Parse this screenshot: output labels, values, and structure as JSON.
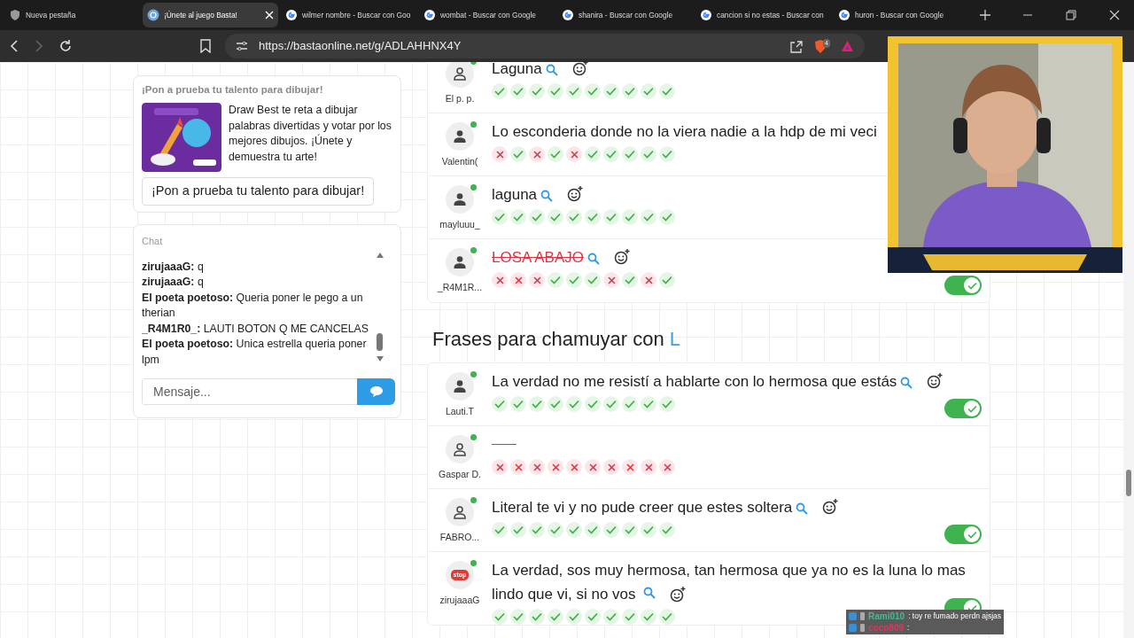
{
  "browser": {
    "tabs": [
      {
        "title": "Nueva pestaña",
        "kind": "shield",
        "selected": false
      },
      {
        "title": "¡Únete al juego Basta!",
        "kind": "game",
        "selected": true
      },
      {
        "title": "wilmer nombre - Buscar con Goo",
        "kind": "search",
        "selected": false
      },
      {
        "title": "wombat - Buscar con Google",
        "kind": "search",
        "selected": false
      },
      {
        "title": "shanira - Buscar con Google",
        "kind": "search",
        "selected": false
      },
      {
        "title": "cancion si no estas - Buscar con",
        "kind": "search",
        "selected": false
      },
      {
        "title": "huron - Buscar con Google",
        "kind": "search",
        "selected": false
      }
    ],
    "address": "https://bastaonline.net/g/ADLAHHNX4Y",
    "shield_count": "4",
    "forward_disabled": true
  },
  "promo": {
    "heading": "¡Pon a prueba tu talento para dibujar!",
    "description": "Draw Best te reta a dibujar palabras divertidas y votar por los mejores dibujos. ¡Únete y demuestra tu arte!",
    "button": "¡Pon a prueba tu talento para dibujar!"
  },
  "chat": {
    "label": "Chat",
    "messages": [
      "**zirujaaaG:** q",
      "**zirujaaaG:** q",
      "**El poeta poetoso:** Queria poner le pego a un therian",
      "**_R4M1R0_:** LAUTI BOTON Q ME CANCELAS",
      "**El poeta poetoso:** Unica estrella queria poner lpm"
    ],
    "placeholder": "Mensaje..."
  },
  "groups": [
    {
      "rows": [
        {
          "name": "El p. p.",
          "kind": "outline",
          "online": true,
          "answer": "Laguna",
          "struck": false,
          "tools": true,
          "votes": [
            {
              "approved": true
            },
            {
              "approved": true
            },
            {
              "approved": true
            },
            {
              "approved": true
            },
            {
              "approved": true
            },
            {
              "approved": true
            },
            {
              "approved": true
            },
            {
              "approved": true
            },
            {
              "approved": true
            },
            {
              "approved": true
            }
          ]
        },
        {
          "name": "Valentin(",
          "kind": "filled",
          "online": true,
          "answer": "Lo esconderia donde no la viera nadie a la hdp de mi veci",
          "struck": false,
          "tools": false,
          "votes": [
            {
              "approved": false
            },
            {
              "approved": true
            },
            {
              "approved": false
            },
            {
              "approved": true
            },
            {
              "approved": false
            },
            {
              "approved": true
            },
            {
              "approved": true
            },
            {
              "approved": true
            },
            {
              "approved": true
            },
            {
              "approved": true
            }
          ]
        },
        {
          "name": "mayluuu_",
          "kind": "filled",
          "online": true,
          "answer": "laguna",
          "struck": false,
          "tools": true,
          "votes": [
            {
              "approved": true
            },
            {
              "approved": true
            },
            {
              "approved": true
            },
            {
              "approved": true
            },
            {
              "approved": true
            },
            {
              "approved": true
            },
            {
              "approved": true
            },
            {
              "approved": true
            },
            {
              "approved": true
            },
            {
              "approved": true
            }
          ]
        },
        {
          "name": "_R4M1R...",
          "kind": "filled",
          "online": true,
          "answer": "LOSA ABAJO",
          "struck": true,
          "tools": true,
          "toggle_on": true,
          "votes": [
            {
              "approved": false
            },
            {
              "approved": false
            },
            {
              "approved": false
            },
            {
              "approved": true
            },
            {
              "approved": true
            },
            {
              "approved": true
            },
            {
              "approved": false
            },
            {
              "approved": true
            },
            {
              "approved": false
            },
            {
              "approved": true
            }
          ]
        }
      ]
    },
    {
      "heading": "Frases para chamuyar con",
      "letter": "L",
      "rows": [
        {
          "name": "Lauti.T",
          "kind": "filled",
          "online": true,
          "answer": "La verdad no me resistí a hablarte con lo hermosa que estás",
          "struck": false,
          "tools": true,
          "toggle_on": true,
          "votes": [
            {
              "approved": true
            },
            {
              "approved": true
            },
            {
              "approved": true
            },
            {
              "approved": true
            },
            {
              "approved": true
            },
            {
              "approved": true
            },
            {
              "approved": true
            },
            {
              "approved": true
            },
            {
              "approved": true
            },
            {
              "approved": true
            }
          ]
        },
        {
          "name": "Gaspar D.",
          "kind": "outline",
          "online": true,
          "struck": true,
          "tools": false,
          "votes": [
            {
              "approved": false
            },
            {
              "approved": false
            },
            {
              "approved": false
            },
            {
              "approved": false
            },
            {
              "approved": false
            },
            {
              "approved": false
            },
            {
              "approved": false
            },
            {
              "approved": false
            },
            {
              "approved": false
            },
            {
              "approved": false
            }
          ]
        },
        {
          "name": "FABRO...",
          "kind": "outline",
          "online": true,
          "answer": "Literal te vi y no pude creer que estes soltera",
          "struck": false,
          "tools": true,
          "toggle_on": true,
          "votes": [
            {
              "approved": true
            },
            {
              "approved": true
            },
            {
              "approved": true
            },
            {
              "approved": true
            },
            {
              "approved": true
            },
            {
              "approved": true
            },
            {
              "approved": true
            },
            {
              "approved": true
            },
            {
              "approved": true
            },
            {
              "approved": true
            }
          ]
        },
        {
          "name": "zirujaaaG",
          "kind": "stop",
          "avatar_text": "stop",
          "online": true,
          "answer": "La verdad, sos muy hermosa, tan hermosa que ya no es la luna lo mas lindo que vi, si no vos",
          "struck": false,
          "tools": true,
          "toggle_on": true,
          "votes": [
            {
              "approved": true
            },
            {
              "approved": true
            },
            {
              "approved": true
            },
            {
              "approved": true
            },
            {
              "approved": true
            },
            {
              "approved": true
            },
            {
              "approved": true
            },
            {
              "approved": true
            },
            {
              "approved": true
            },
            {
              "approved": true
            }
          ]
        }
      ]
    }
  ],
  "stream_chat": [
    {
      "user": "Rami010",
      "color": "#3fbf8f",
      "text": ": toy re fumado perdn ajsjas"
    },
    {
      "user": "coco809",
      "color": "#d83a5a",
      "text": ":"
    }
  ]
}
